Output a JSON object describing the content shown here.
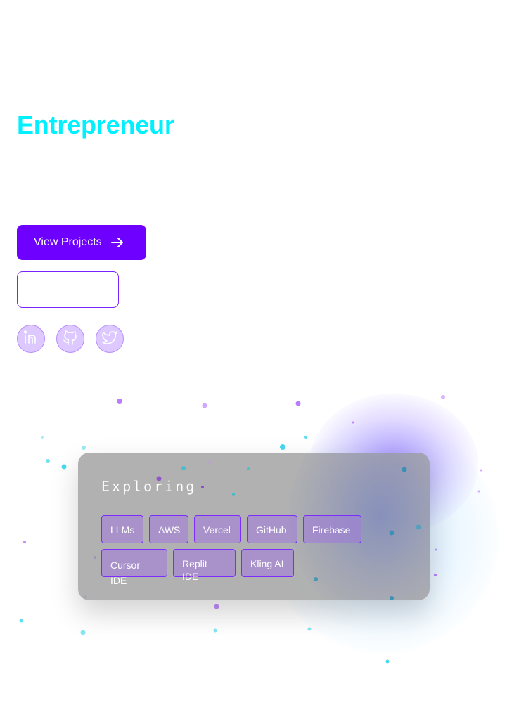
{
  "hero": {
    "title": "Entrepreneur",
    "title_color": "#00f0ff"
  },
  "actions": {
    "primary_label": "View Projects",
    "primary_icon": "arrow-right-icon",
    "primary_color": "#6e00ff",
    "secondary_label": ""
  },
  "socials": [
    {
      "name": "linkedin",
      "icon": "linkedin-icon"
    },
    {
      "name": "github",
      "icon": "github-icon"
    },
    {
      "name": "twitter",
      "icon": "twitter-icon"
    }
  ],
  "exploring": {
    "title": "Exploring",
    "tags": [
      "LLMs",
      "AWS",
      "Vercel",
      "GitHub",
      "Firebase",
      "Cursor IDE",
      "Replit IDE",
      "Kling AI"
    ]
  },
  "colors": {
    "accent_purple": "#7b2cff",
    "particle_cyan": "#33d6ee",
    "particle_purple": "#b070ff"
  }
}
